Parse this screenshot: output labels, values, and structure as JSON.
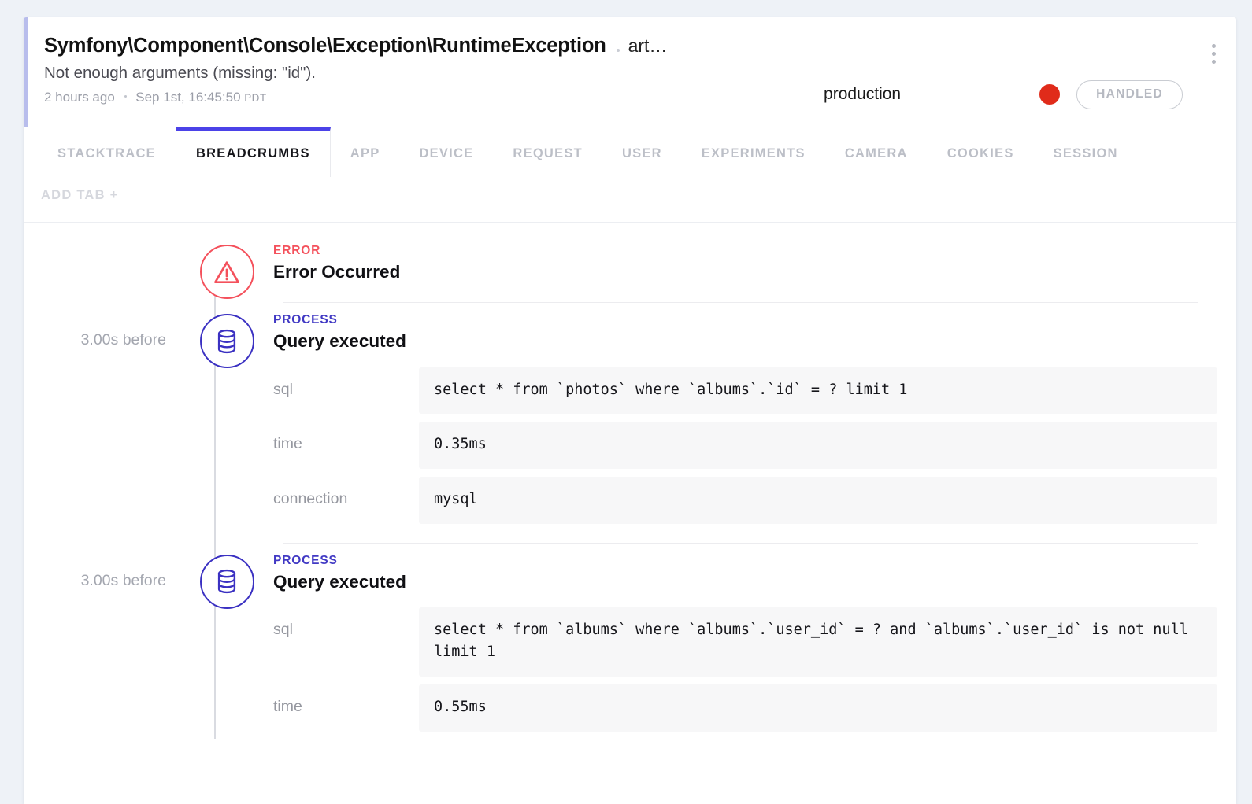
{
  "header": {
    "title": "Symfony\\Component\\Console\\Exception\\RuntimeException",
    "title_suffix": "art…",
    "message": "Not enough arguments (missing: \"id\").",
    "relative_time": "2 hours ago",
    "absolute_time": "Sep 1st, 16:45:50",
    "timezone": "PDT",
    "environment": "production",
    "status_badge": "HANDLED",
    "severity_color": "#e02b1a",
    "accent_color": "#b8bdec",
    "menu_icon": "kebab-menu-icon"
  },
  "tabs": {
    "items": [
      {
        "label": "STACKTRACE",
        "active": false
      },
      {
        "label": "BREADCRUMBS",
        "active": true
      },
      {
        "label": "APP",
        "active": false
      },
      {
        "label": "DEVICE",
        "active": false
      },
      {
        "label": "REQUEST",
        "active": false
      },
      {
        "label": "USER",
        "active": false
      },
      {
        "label": "EXPERIMENTS",
        "active": false
      },
      {
        "label": "CAMERA",
        "active": false
      },
      {
        "label": "COOKIES",
        "active": false
      },
      {
        "label": "SESSION",
        "active": false
      }
    ],
    "add_tab_label": "ADD TAB +",
    "active_color": "#4b42e8"
  },
  "breadcrumbs": [
    {
      "time": "",
      "category": "ERROR",
      "name": "Error Occurred",
      "icon": "warning-triangle-icon",
      "kind": "error",
      "meta": []
    },
    {
      "time": "3.00s before",
      "category": "PROCESS",
      "name": "Query executed",
      "icon": "database-icon",
      "kind": "process",
      "meta": [
        {
          "key": "sql",
          "value": "select * from `photos` where `albums`.`id` = ? limit 1"
        },
        {
          "key": "time",
          "value": "0.35ms"
        },
        {
          "key": "connection",
          "value": "mysql"
        }
      ]
    },
    {
      "time": "3.00s before",
      "category": "PROCESS",
      "name": "Query executed",
      "icon": "database-icon",
      "kind": "process",
      "meta": [
        {
          "key": "sql",
          "value": "select * from `albums` where `albums`.`user_id` = ? and `albums`.`user_id` is not null limit 1"
        },
        {
          "key": "time",
          "value": "0.55ms"
        }
      ]
    }
  ]
}
